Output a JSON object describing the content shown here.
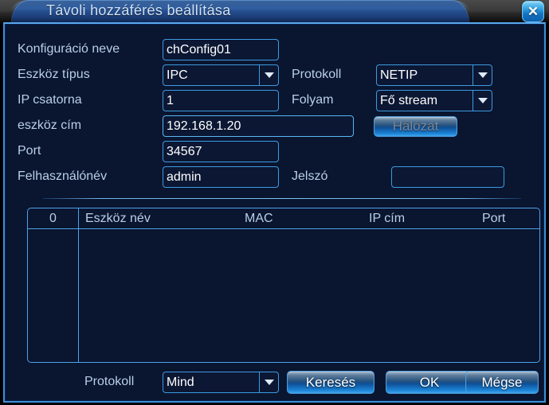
{
  "window": {
    "title": "Távoli hozzáférés beállítása",
    "close_icon": "close-icon"
  },
  "form": {
    "config_name": {
      "label": "Konfiguráció neve",
      "value": "chConfig01"
    },
    "device_type": {
      "label": "Eszköz típus",
      "value": "IPC"
    },
    "protocol": {
      "label": "Protokoll",
      "value": "NETIP"
    },
    "ip_channel": {
      "label": "IP csatorna",
      "value": "1"
    },
    "stream": {
      "label": "Folyam",
      "value": "Fő stream"
    },
    "device_addr": {
      "label": "eszköz cím",
      "value": "192.168.1.20"
    },
    "network_button": {
      "label": "Hálózat",
      "enabled": false
    },
    "port": {
      "label": "Port",
      "value": "34567"
    },
    "username": {
      "label": "Felhasználónév",
      "value": "admin"
    },
    "password": {
      "label": "Jelszó",
      "value": ""
    }
  },
  "table": {
    "columns": [
      "0",
      "Eszköz név",
      "MAC",
      "IP cím",
      "Port"
    ],
    "rows": []
  },
  "footer": {
    "protocol_label": "Protokoll",
    "protocol_value": "Mind",
    "search_button": "Keresés",
    "ok_button": "OK",
    "cancel_button": "Mégse"
  },
  "colors": {
    "accent": "#3e9ae0",
    "dialog_bg": "#0a1530",
    "label_text": "#b9cfe8",
    "value_text": "#ffffff"
  }
}
